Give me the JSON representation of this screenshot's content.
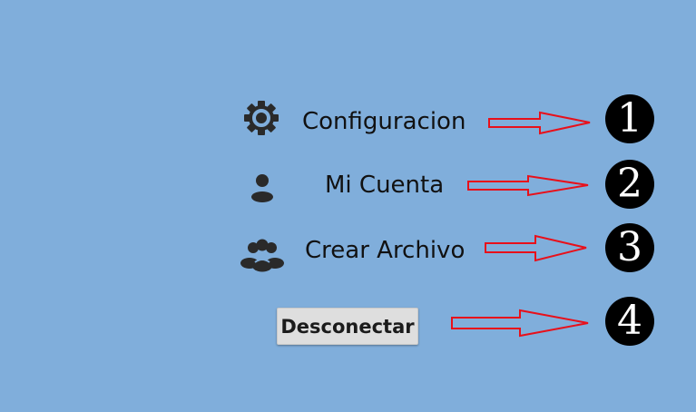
{
  "menu": {
    "items": [
      {
        "label": "Configuracion",
        "icon": "gear-icon"
      },
      {
        "label": "Mi Cuenta",
        "icon": "person-icon"
      },
      {
        "label": "Crear Archivo",
        "icon": "group-icon"
      }
    ],
    "logout_label": "Desconectar"
  },
  "annotations": {
    "badges": [
      "1",
      "2",
      "3",
      "4"
    ],
    "arrow_color": "#e8101a",
    "badge_color": "#000000"
  },
  "theme": {
    "background": "#80aedb",
    "icon_color": "#2a2a2a"
  }
}
